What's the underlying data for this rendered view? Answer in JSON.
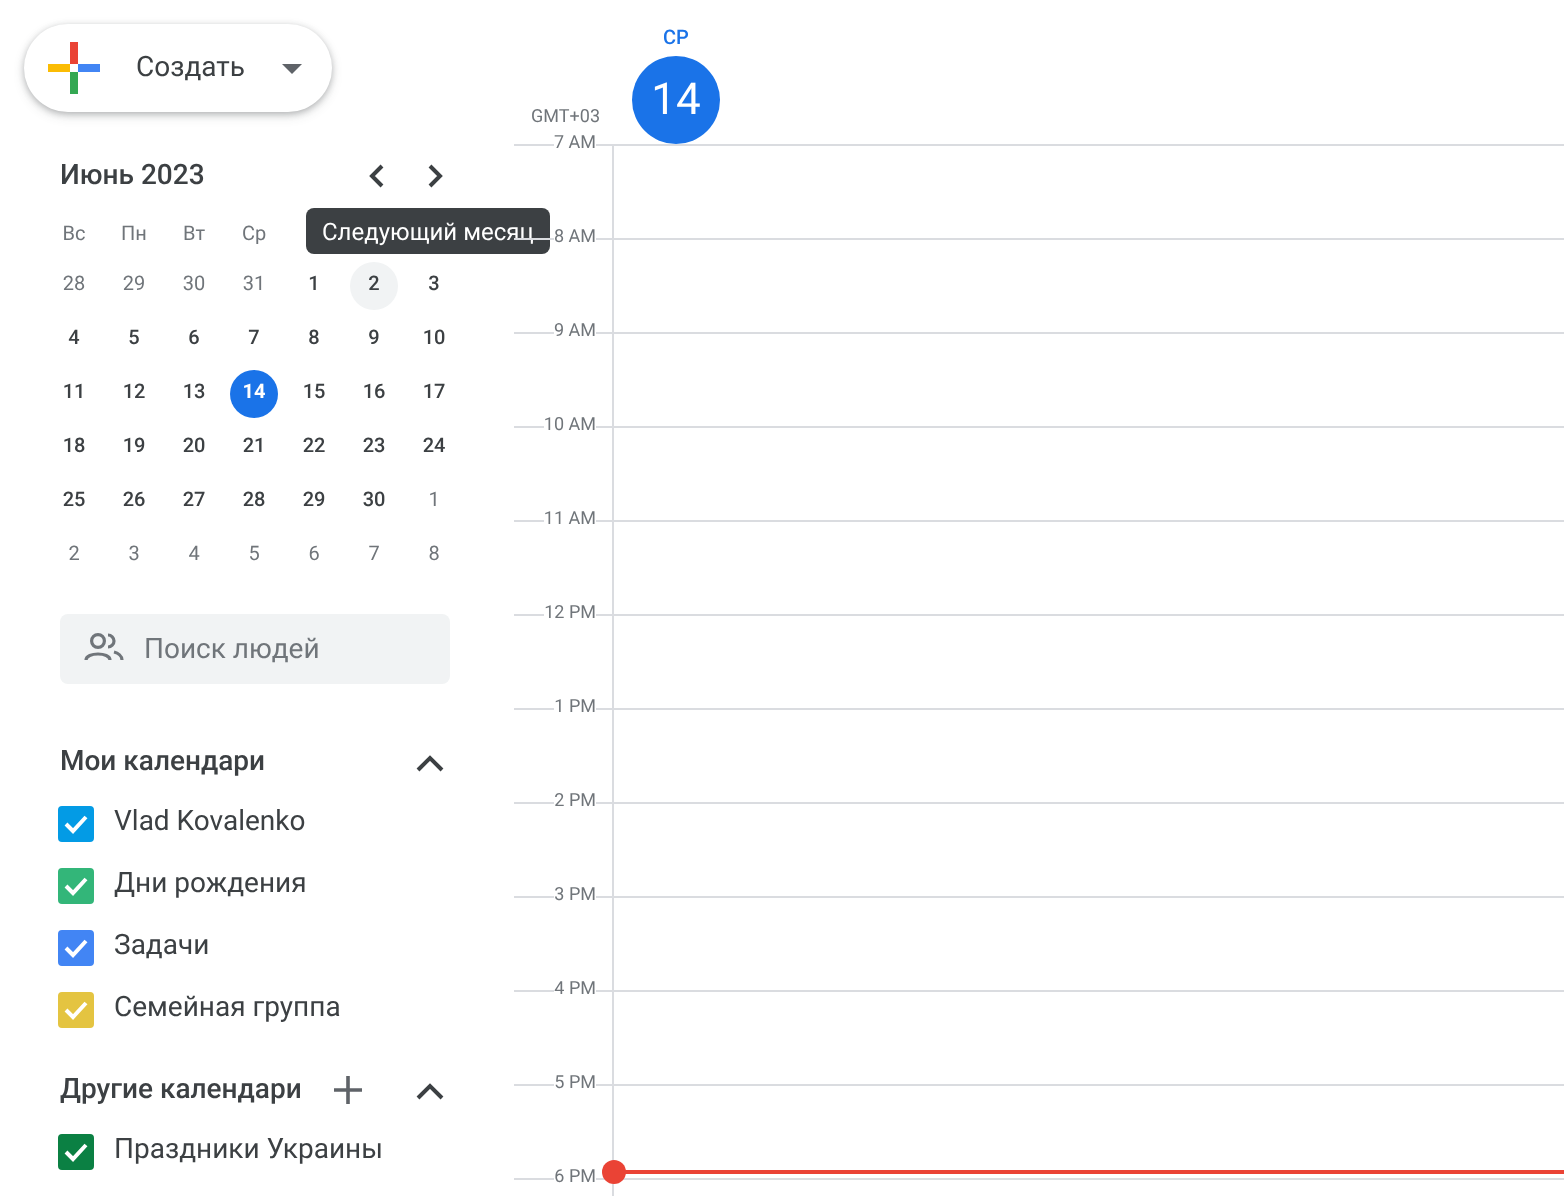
{
  "create_button": {
    "label": "Создать"
  },
  "mini_calendar": {
    "title": "Июнь 2023",
    "tooltip": "Следующий месяц",
    "weekdays": [
      "Вс",
      "Пн",
      "Вт",
      "Ср"
    ],
    "weeks": [
      [
        {
          "day": "28",
          "muted": true,
          "selected": false,
          "hovered": false
        },
        {
          "day": "29",
          "muted": true,
          "selected": false,
          "hovered": false
        },
        {
          "day": "30",
          "muted": true,
          "selected": false,
          "hovered": false
        },
        {
          "day": "31",
          "muted": true,
          "selected": false,
          "hovered": false
        },
        {
          "day": "1",
          "muted": false,
          "selected": false,
          "hovered": false
        },
        {
          "day": "2",
          "muted": false,
          "selected": false,
          "hovered": true
        },
        {
          "day": "3",
          "muted": false,
          "selected": false,
          "hovered": false
        }
      ],
      [
        {
          "day": "4",
          "muted": false,
          "selected": false,
          "hovered": false
        },
        {
          "day": "5",
          "muted": false,
          "selected": false,
          "hovered": false
        },
        {
          "day": "6",
          "muted": false,
          "selected": false,
          "hovered": false
        },
        {
          "day": "7",
          "muted": false,
          "selected": false,
          "hovered": false
        },
        {
          "day": "8",
          "muted": false,
          "selected": false,
          "hovered": false
        },
        {
          "day": "9",
          "muted": false,
          "selected": false,
          "hovered": false
        },
        {
          "day": "10",
          "muted": false,
          "selected": false,
          "hovered": false
        }
      ],
      [
        {
          "day": "11",
          "muted": false,
          "selected": false,
          "hovered": false
        },
        {
          "day": "12",
          "muted": false,
          "selected": false,
          "hovered": false
        },
        {
          "day": "13",
          "muted": false,
          "selected": false,
          "hovered": false
        },
        {
          "day": "14",
          "muted": false,
          "selected": true,
          "hovered": false
        },
        {
          "day": "15",
          "muted": false,
          "selected": false,
          "hovered": false
        },
        {
          "day": "16",
          "muted": false,
          "selected": false,
          "hovered": false
        },
        {
          "day": "17",
          "muted": false,
          "selected": false,
          "hovered": false
        }
      ],
      [
        {
          "day": "18",
          "muted": false,
          "selected": false,
          "hovered": false
        },
        {
          "day": "19",
          "muted": false,
          "selected": false,
          "hovered": false
        },
        {
          "day": "20",
          "muted": false,
          "selected": false,
          "hovered": false
        },
        {
          "day": "21",
          "muted": false,
          "selected": false,
          "hovered": false
        },
        {
          "day": "22",
          "muted": false,
          "selected": false,
          "hovered": false
        },
        {
          "day": "23",
          "muted": false,
          "selected": false,
          "hovered": false
        },
        {
          "day": "24",
          "muted": false,
          "selected": false,
          "hovered": false
        }
      ],
      [
        {
          "day": "25",
          "muted": false,
          "selected": false,
          "hovered": false
        },
        {
          "day": "26",
          "muted": false,
          "selected": false,
          "hovered": false
        },
        {
          "day": "27",
          "muted": false,
          "selected": false,
          "hovered": false
        },
        {
          "day": "28",
          "muted": false,
          "selected": false,
          "hovered": false
        },
        {
          "day": "29",
          "muted": false,
          "selected": false,
          "hovered": false
        },
        {
          "day": "30",
          "muted": false,
          "selected": false,
          "hovered": false
        },
        {
          "day": "1",
          "muted": true,
          "selected": false,
          "hovered": false
        }
      ],
      [
        {
          "day": "2",
          "muted": true,
          "selected": false,
          "hovered": false
        },
        {
          "day": "3",
          "muted": true,
          "selected": false,
          "hovered": false
        },
        {
          "day": "4",
          "muted": true,
          "selected": false,
          "hovered": false
        },
        {
          "day": "5",
          "muted": true,
          "selected": false,
          "hovered": false
        },
        {
          "day": "6",
          "muted": true,
          "selected": false,
          "hovered": false
        },
        {
          "day": "7",
          "muted": true,
          "selected": false,
          "hovered": false
        },
        {
          "day": "8",
          "muted": true,
          "selected": false,
          "hovered": false
        }
      ]
    ]
  },
  "people_search": {
    "placeholder": "Поиск людей"
  },
  "my_calendars": {
    "title": "Мои календари",
    "expanded": true,
    "items": [
      {
        "label": "Vlad Kovalenko",
        "checked": true,
        "color": "#039be5"
      },
      {
        "label": "Дни рождения",
        "checked": true,
        "color": "#33b679"
      },
      {
        "label": "Задачи",
        "checked": true,
        "color": "#4285f4"
      },
      {
        "label": "Семейная группа",
        "checked": true,
        "color": "#e4c441"
      }
    ]
  },
  "other_calendars": {
    "title": "Другие календари",
    "expanded": true,
    "items": [
      {
        "label": "Праздники Украины",
        "checked": true,
        "color": "#0b8043"
      }
    ]
  },
  "day_view": {
    "weekday": "СР",
    "date": "14",
    "today": true,
    "timezone": "GMT+03",
    "hours": [
      "7 AM",
      "8 AM",
      "9 AM",
      "10 AM",
      "11 AM",
      "12 PM",
      "1 PM",
      "2 PM",
      "3 PM",
      "4 PM",
      "5 PM",
      "6 PM"
    ]
  }
}
